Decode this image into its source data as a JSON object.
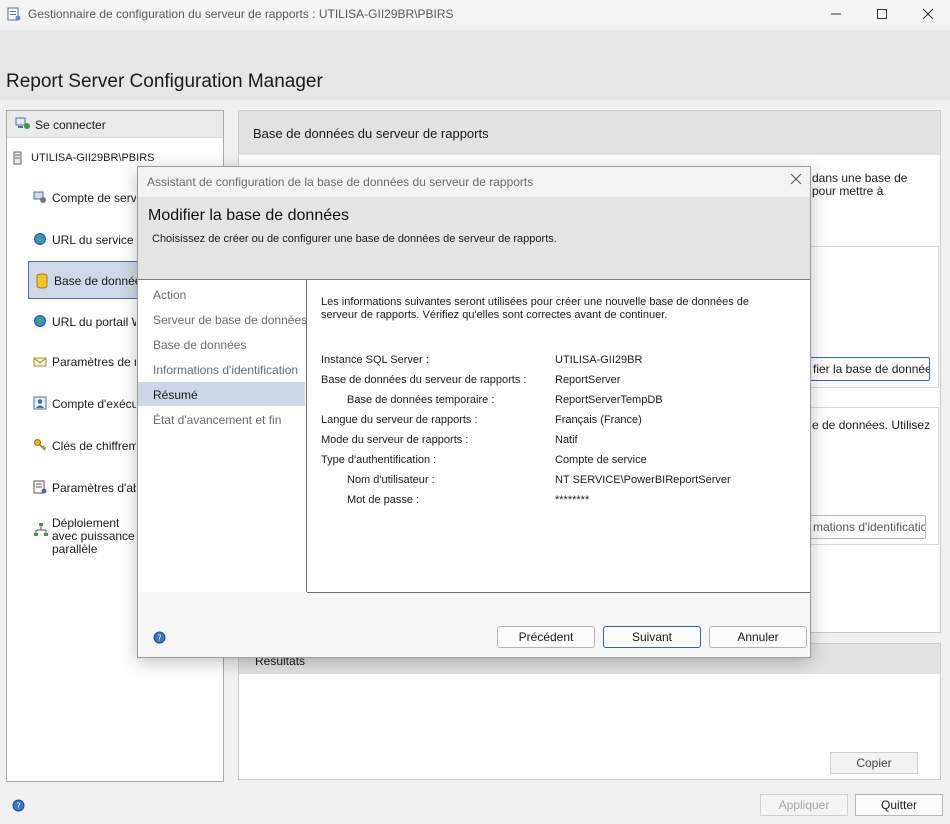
{
  "window": {
    "title": "Gestionnaire de configuration du serveur de rapports : UTILISA-GII29BR\\PBIRS",
    "app_title": "Report Server Configuration Manager"
  },
  "sidebar": {
    "connect_label": "Se connecter",
    "server": "UTILISA-GII29BR\\PBIRS",
    "items": [
      {
        "label": "Compte de service",
        "icon": "service-account-icon"
      },
      {
        "label": "URL du service Web",
        "icon": "web-url-icon"
      },
      {
        "label": "Base de données",
        "icon": "database-icon",
        "selected": true
      },
      {
        "label": "URL du portail Web",
        "icon": "portal-url-icon"
      },
      {
        "label": "Paramètres de messagerie",
        "icon": "email-settings-icon"
      },
      {
        "label": "Compte d'exécution",
        "icon": "execution-account-icon"
      },
      {
        "label": "Clés de chiffrement",
        "icon": "encryption-keys-icon"
      },
      {
        "label": "Paramètres d'abonnement",
        "icon": "subscription-settings-icon"
      },
      {
        "label": "Déploiement avec puissance parallèle",
        "icon": "scale-out-icon"
      }
    ]
  },
  "content": {
    "header": "Base de données du serveur de rapports",
    "text_line1": "dans une base de",
    "text_line2": "pour mettre à",
    "change_db_btn": "fier la base de données",
    "text2": "e de données. Utilisez",
    "credentials_btn": "mations d'identification",
    "results_header": "Résultats",
    "copy_btn": "Copier"
  },
  "footer": {
    "apply": "Appliquer",
    "quit": "Quitter"
  },
  "dialog": {
    "title": "Assistant de configuration de la base de données du serveur de rapports",
    "heading": "Modifier la base de données",
    "subheading": "Choisissez de créer ou de configurer une base de données de serveur de rapports.",
    "steps": [
      {
        "label": "Action"
      },
      {
        "label": "Serveur de base de données"
      },
      {
        "label": "Base de données"
      },
      {
        "label": "Informations d'identification"
      },
      {
        "label": "Résumé",
        "active": true
      },
      {
        "label": "État d'avancement et fin"
      }
    ],
    "intro": "Les informations suivantes seront utilisées pour créer une nouvelle base de données de serveur de rapports. Vérifiez qu'elles sont correctes avant de continuer.",
    "summary": [
      {
        "k": "Instance SQL Server :",
        "v": "UTILISA-GII29BR",
        "indent": false
      },
      {
        "k": "Base de données du serveur de rapports :",
        "v": "ReportServer",
        "indent": false
      },
      {
        "k": "Base de données temporaire :",
        "v": "ReportServerTempDB",
        "indent": true
      },
      {
        "k": "Langue du serveur de rapports :",
        "v": "Français (France)",
        "indent": false
      },
      {
        "k": "Mode du serveur de rapports :",
        "v": "Natif",
        "indent": false
      },
      {
        "k": "Type d'authentification :",
        "v": "Compte de service",
        "indent": false
      },
      {
        "k": "Nom d'utilisateur :",
        "v": "NT SERVICE\\PowerBIReportServer",
        "indent": true
      },
      {
        "k": "Mot de passe :",
        "v": "********",
        "indent": true
      }
    ],
    "buttons": {
      "prev": "Précédent",
      "next": "Suivant",
      "cancel": "Annuler"
    }
  }
}
